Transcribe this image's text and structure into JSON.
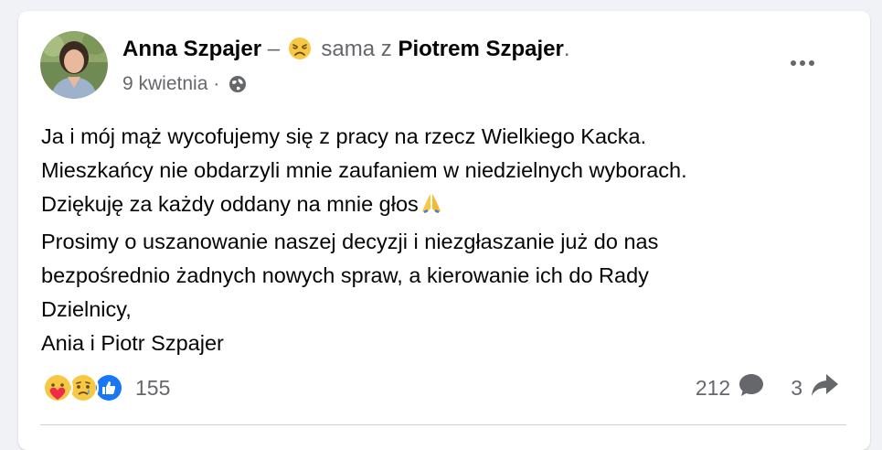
{
  "post": {
    "author": "Anna Szpajer",
    "dash": "–",
    "feeling_icon": "tired-face-emoji",
    "with_text": "sama z",
    "tagged_person": "Piotrem Szpajer",
    "end_punct": ".",
    "date": "9 kwietnia",
    "separator": "·",
    "privacy_icon": "globe-icon",
    "more_icon": "more-horizontal-icon",
    "lines": [
      "Ja i mój mąż wycofujemy się z pracy na rzecz Wielkiego Kacka.",
      "Mieszkańcy nie obdarzyli mnie zaufaniem w niedzielnych wyborach.",
      "Dziękuję za każdy oddany na mnie głos",
      "Prosimy o uszanowanie naszej decyzji i niezgłaszanie już do nas",
      "bezpośrednio żadnych nowych spraw, a kierowanie ich do Rady",
      "Dzielnicy,",
      "Ania i Piotr Szpajer"
    ],
    "pray_icon": "folded-hands-emoji"
  },
  "footer": {
    "reactions": [
      "care-reaction",
      "sad-reaction",
      "like-reaction"
    ],
    "reaction_count": "155",
    "comment_count": "212",
    "comment_icon": "comment-icon",
    "share_count": "3",
    "share_icon": "share-icon"
  },
  "colors": {
    "background": "#f0f2f5",
    "card": "#ffffff",
    "text": "#050505",
    "muted": "#65676b",
    "like_blue": "#1877f2",
    "emoji_yellow": "#f7c844"
  }
}
